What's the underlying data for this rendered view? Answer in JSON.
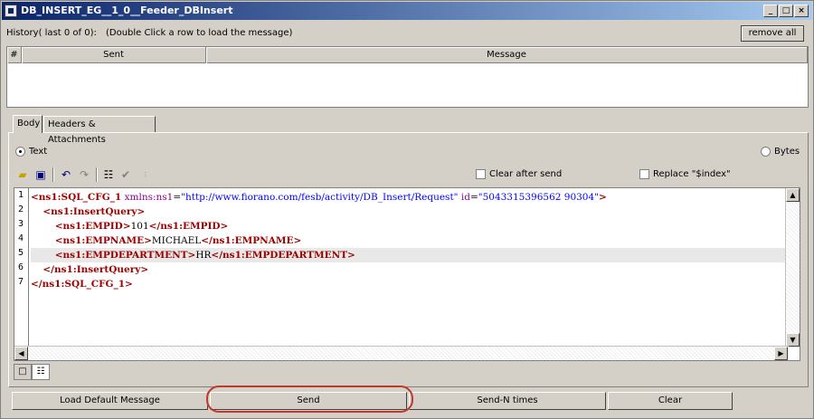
{
  "window": {
    "title": "DB_INSERT_EG__1_0__Feeder_DBInsert"
  },
  "history": {
    "label": "History( last 0 of 0):",
    "note": "(Double Click a row to load the message)",
    "remove_all": "remove all",
    "columns": [
      "#",
      "Sent",
      "Message"
    ]
  },
  "tabs": [
    "Body",
    "Headers & Attachments"
  ],
  "format": {
    "text_label": "Text",
    "bytes_label": "Bytes",
    "selected": "Text"
  },
  "toolbar": {
    "icons": [
      "open-folder-icon",
      "save-icon",
      "undo-icon",
      "redo-icon",
      "format-icon",
      "validate-icon",
      "xpath-icon"
    ],
    "clear_after_send": "Clear after send",
    "replace_index": "Replace \"$index\""
  },
  "editor": {
    "line_numbers": [
      "1",
      "2",
      "3",
      "4",
      "5",
      "6",
      "7"
    ],
    "highlighted_line": 5,
    "lines": [
      [
        {
          "t": "tg",
          "v": "<ns1:SQL_CFG_1"
        },
        {
          "t": "tx",
          "v": " "
        },
        {
          "t": "attr",
          "v": "xmlns:ns1"
        },
        {
          "t": "tx",
          "v": "="
        },
        {
          "t": "av",
          "v": "\"http://www.fiorano.com/fesb/activity/DB_Insert/Request\""
        },
        {
          "t": "tx",
          "v": " "
        },
        {
          "t": "attr",
          "v": "id"
        },
        {
          "t": "tx",
          "v": "="
        },
        {
          "t": "av",
          "v": "\"5043315396562 90304\""
        },
        {
          "t": "tg",
          "v": ">"
        }
      ],
      [
        {
          "t": "tx",
          "v": "    "
        },
        {
          "t": "tg",
          "v": "<ns1:InsertQuery>"
        }
      ],
      [
        {
          "t": "tx",
          "v": "        "
        },
        {
          "t": "tg",
          "v": "<ns1:EMPID>"
        },
        {
          "t": "tx",
          "v": "101"
        },
        {
          "t": "tg",
          "v": "</ns1:EMPID>"
        }
      ],
      [
        {
          "t": "tx",
          "v": "        "
        },
        {
          "t": "tg",
          "v": "<ns1:EMPNAME>"
        },
        {
          "t": "tx",
          "v": "MICHAEL"
        },
        {
          "t": "tg",
          "v": "</ns1:EMPNAME>"
        }
      ],
      [
        {
          "t": "tx",
          "v": "        "
        },
        {
          "t": "tg",
          "v": "<ns1:EMPDEPARTMENT>"
        },
        {
          "t": "tx",
          "v": "HR"
        },
        {
          "t": "tg",
          "v": "</ns1:EMPDEPARTMENT>"
        }
      ],
      [
        {
          "t": "tx",
          "v": "    "
        },
        {
          "t": "tg",
          "v": "</ns1:InsertQuery>"
        }
      ],
      [
        {
          "t": "tg",
          "v": "</ns1:SQL_CFG_1>"
        }
      ]
    ]
  },
  "buttons": {
    "load_default": "Load Default Message",
    "send": "Send",
    "send_n": "Send-N times",
    "clear": "Clear"
  },
  "colors": {
    "tag": "#a00000",
    "attr": "#8b008b",
    "value": "#0000ff",
    "highlight_ring": "#c0392b"
  }
}
